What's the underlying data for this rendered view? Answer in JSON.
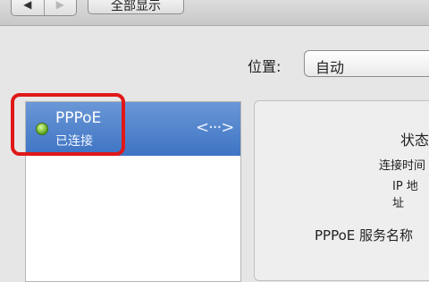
{
  "toolbar": {
    "back_label": "◀",
    "forward_label": "▶",
    "show_all_label": "全部显示"
  },
  "location": {
    "label": "位置:",
    "value": "自动"
  },
  "services": [
    {
      "name": "PPPoE",
      "status": "已连接",
      "status_color": "#5aa21a"
    }
  ],
  "detail": {
    "status_label": "状态",
    "connect_time_label": "连接时间",
    "ip_label": "IP 地址",
    "service_name_label": "PPPoE 服务名称"
  },
  "colors": {
    "selection": "#3e74c4",
    "highlight_box": "#e01818"
  }
}
